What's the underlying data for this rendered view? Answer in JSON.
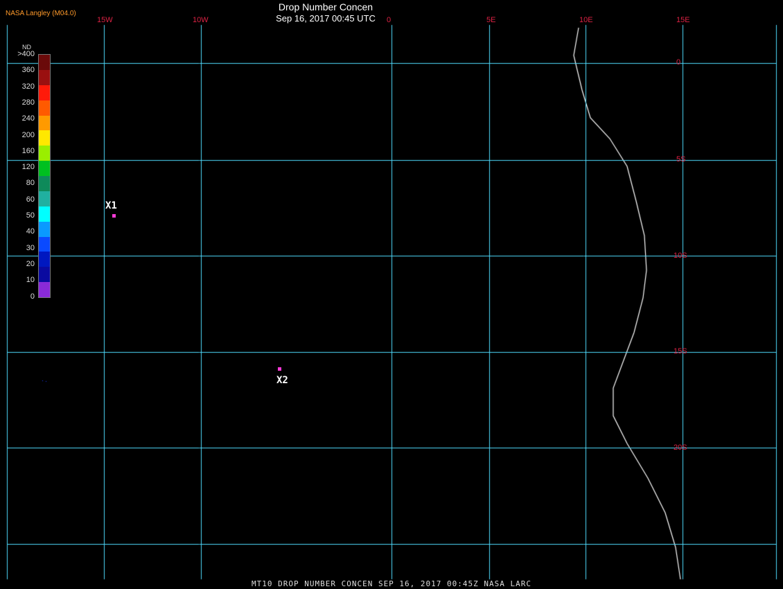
{
  "header": {
    "title": "Drop Number Concen",
    "datetime": "Sep 16, 2017 00:45 UTC",
    "credit": "NASA Langley (M04.0)"
  },
  "footer": {
    "text": "MT10  DROP NUMBER CONCEN   SEP 16, 2017 00:45Z   NASA LARC"
  },
  "legend": {
    "title": "ND",
    "labels": [
      ">400",
      "360",
      "320",
      "280",
      "240",
      "200",
      "160",
      "120",
      "80",
      "60",
      "50",
      "40",
      "30",
      "20",
      "10",
      "0"
    ],
    "colors": [
      "#6a0a0a",
      "#9a1010",
      "#ff1a0a",
      "#ff5a00",
      "#ff9a00",
      "#ffe800",
      "#9aee00",
      "#00c020",
      "#0e8a5a",
      "#20b0a0",
      "#00ffff",
      "#0a9aff",
      "#0a4aff",
      "#0018c0",
      "#0a0aa0",
      "#8a2ad8"
    ]
  },
  "map": {
    "lon_labels": [
      "15W",
      "10W",
      "0",
      "5E",
      "10E",
      "15E"
    ],
    "lat_labels": [
      "0",
      "5S",
      "10S",
      "15S",
      "20S"
    ],
    "grid_color": "#4fdcff",
    "markers": [
      {
        "label": "X1"
      },
      {
        "label": "X2"
      }
    ]
  }
}
